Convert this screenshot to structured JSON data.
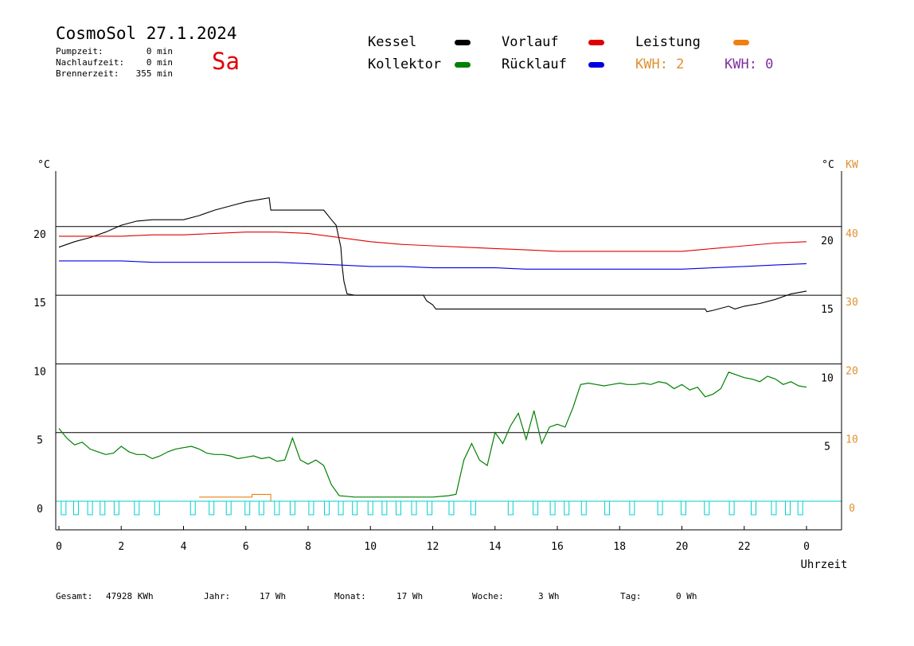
{
  "header": {
    "title": "CosmoSol 27.1.2024",
    "weekday": "Sa",
    "stats": [
      {
        "label": "Pumpzeit:",
        "value": "0 min"
      },
      {
        "label": "Nachlaufzeit:",
        "value": "0 min"
      },
      {
        "label": "Brennerzeit:",
        "value": "355 min"
      }
    ]
  },
  "legend": {
    "kessel": {
      "label": "Kessel",
      "color": "#000000"
    },
    "vorlauf": {
      "label": "Vorlauf",
      "color": "#e00000"
    },
    "leistung": {
      "label": "Leistung",
      "color": "#f08010"
    },
    "kollektor": {
      "label": "Kollektor",
      "color": "#008000"
    },
    "ruecklauf": {
      "label": "Rücklauf",
      "color": "#0000e0"
    },
    "kwh1": "KWH: 2",
    "kwh2": "KWH: 0",
    "kwh1_color": "#e09030",
    "kwh2_color": "#8030a0"
  },
  "footer": [
    {
      "label": "Gesamt:",
      "value": "47928 KWh"
    },
    {
      "label": "Jahr:",
      "value": "17 Wh"
    },
    {
      "label": "Monat:",
      "value": "17 Wh"
    },
    {
      "label": "Woche:",
      "value": "3 Wh"
    },
    {
      "label": "Tag:",
      "value": "0 Wh"
    }
  ],
  "chart_data": {
    "type": "line",
    "xlabel": "Uhrzeit",
    "y_unit_left": "°C",
    "y_unit_right": "°C",
    "y_unit_kw": "KW",
    "xlim": [
      0,
      24
    ],
    "ylim": [
      -2,
      24.5
    ],
    "x_ticks": [
      "0",
      "2",
      "4",
      "6",
      "8",
      "10",
      "12",
      "14",
      "16",
      "18",
      "20",
      "22",
      "0"
    ],
    "y_ticks_left": [
      "0",
      "5",
      "10",
      "15",
      "20"
    ],
    "y_ticks_right": [
      "5",
      "10",
      "15",
      "20"
    ],
    "kw_ticks": [
      "0",
      "10",
      "20",
      "30",
      "40"
    ],
    "series": [
      {
        "name": "Kessel",
        "color": "#000000",
        "x": [
          0,
          0.5,
          1,
          1.5,
          2,
          2.5,
          3,
          4,
          4.5,
          5,
          5.5,
          6,
          6.5,
          6.75,
          6.8,
          7,
          7.5,
          8,
          8.5,
          8.75,
          8.9,
          9.05,
          9.1,
          9.15,
          9.25,
          9.5,
          10,
          11,
          11.7,
          11.8,
          12,
          12.1,
          12.5,
          13,
          14,
          16,
          18,
          20,
          20.75,
          20.8,
          21,
          21.5,
          21.7,
          22,
          22.5,
          23,
          23.5,
          24
        ],
        "y": [
          18.5,
          18.9,
          19.2,
          19.6,
          20.1,
          20.4,
          20.5,
          20.5,
          20.8,
          21.2,
          21.5,
          21.8,
          22.0,
          22.1,
          21.2,
          21.2,
          21.2,
          21.2,
          21.2,
          20.5,
          20.1,
          18.5,
          17.0,
          16.0,
          15.1,
          15.0,
          15.0,
          15.0,
          15.0,
          14.6,
          14.3,
          14.0,
          14.0,
          14.0,
          14.0,
          14.0,
          14.0,
          14.0,
          14.0,
          13.8,
          13.9,
          14.2,
          14.0,
          14.2,
          14.4,
          14.7,
          15.1,
          15.3
        ]
      },
      {
        "name": "Vorlauf",
        "color": "#e00000",
        "x": [
          0,
          1,
          2,
          3,
          4,
          5,
          6,
          7,
          8,
          9,
          10,
          11,
          12,
          13,
          14,
          15,
          16,
          17,
          18,
          19,
          20,
          21,
          22,
          23,
          24
        ],
        "y": [
          19.3,
          19.3,
          19.3,
          19.4,
          19.4,
          19.5,
          19.6,
          19.6,
          19.5,
          19.2,
          18.9,
          18.7,
          18.6,
          18.5,
          18.4,
          18.3,
          18.2,
          18.2,
          18.2,
          18.2,
          18.2,
          18.4,
          18.6,
          18.8,
          18.9
        ]
      },
      {
        "name": "Rücklauf",
        "color": "#0000e0",
        "x": [
          0,
          1,
          2,
          3,
          4,
          5,
          6,
          7,
          8,
          9,
          10,
          11,
          12,
          13,
          14,
          15,
          16,
          17,
          18,
          19,
          20,
          21,
          22,
          23,
          24
        ],
        "y": [
          17.5,
          17.5,
          17.5,
          17.4,
          17.4,
          17.4,
          17.4,
          17.4,
          17.3,
          17.2,
          17.1,
          17.1,
          17.0,
          17.0,
          17.0,
          16.9,
          16.9,
          16.9,
          16.9,
          16.9,
          16.9,
          17.0,
          17.1,
          17.2,
          17.3
        ]
      },
      {
        "name": "Kollektor",
        "color": "#008000",
        "x": [
          0,
          0.25,
          0.5,
          0.75,
          1,
          1.25,
          1.5,
          1.75,
          2,
          2.25,
          2.5,
          2.75,
          3,
          3.25,
          3.5,
          3.75,
          4,
          4.25,
          4.5,
          4.75,
          5,
          5.25,
          5.5,
          5.75,
          6,
          6.25,
          6.5,
          6.75,
          7,
          7.25,
          7.5,
          7.75,
          8,
          8.25,
          8.5,
          8.75,
          9,
          9.5,
          10,
          10.5,
          11,
          11.5,
          12,
          12.5,
          12.75,
          13,
          13.25,
          13.5,
          13.75,
          14,
          14.25,
          14.5,
          14.75,
          15,
          15.25,
          15.5,
          15.75,
          16,
          16.25,
          16.5,
          16.75,
          17,
          17.25,
          17.5,
          17.75,
          18,
          18.25,
          18.5,
          18.75,
          19,
          19.25,
          19.5,
          19.75,
          20,
          20.25,
          20.5,
          20.75,
          21,
          21.25,
          21.5,
          21.75,
          22,
          22.25,
          22.5,
          22.75,
          23,
          23.25,
          23.5,
          23.75,
          24
        ],
        "y": [
          5.3,
          4.6,
          4.1,
          4.3,
          3.8,
          3.6,
          3.4,
          3.5,
          4.0,
          3.6,
          3.4,
          3.4,
          3.1,
          3.3,
          3.6,
          3.8,
          3.9,
          4.0,
          3.8,
          3.5,
          3.4,
          3.4,
          3.3,
          3.1,
          3.2,
          3.3,
          3.1,
          3.2,
          2.9,
          3.0,
          4.6,
          3.0,
          2.7,
          3.0,
          2.6,
          1.2,
          0.4,
          0.3,
          0.3,
          0.3,
          0.3,
          0.3,
          0.3,
          0.4,
          0.5,
          3.0,
          4.2,
          3.0,
          2.6,
          5.0,
          4.2,
          5.5,
          6.4,
          4.5,
          6.6,
          4.2,
          5.4,
          5.6,
          5.4,
          6.8,
          8.5,
          8.6,
          8.5,
          8.4,
          8.5,
          8.6,
          8.5,
          8.5,
          8.6,
          8.5,
          8.7,
          8.6,
          8.2,
          8.5,
          8.1,
          8.3,
          7.6,
          7.8,
          8.2,
          9.4,
          9.2,
          9.0,
          8.9,
          8.7,
          9.1,
          8.9,
          8.5,
          8.7,
          8.4,
          8.3
        ]
      },
      {
        "name": "Leistung",
        "color": "#f08010",
        "axis": "kw",
        "x": [
          4.5,
          4.8,
          4.8,
          5.1,
          5.1,
          5.5,
          5.5,
          5.9,
          5.9,
          6.2,
          6.2,
          6.5,
          6.5,
          6.8,
          6.8
        ],
        "y": [
          0.6,
          0.6,
          0.6,
          0.6,
          0.6,
          0.6,
          0.6,
          0.6,
          0.6,
          0.6,
          1.0,
          1.0,
          1.0,
          1.0,
          0.0
        ]
      },
      {
        "name": "Pumpe",
        "color": "#00d0d0",
        "type": "pulses",
        "x": [
          0.15,
          0.55,
          1.0,
          1.4,
          1.85,
          2.5,
          3.15,
          4.3,
          4.9,
          5.45,
          6.05,
          6.5,
          7.0,
          7.5,
          8.1,
          8.6,
          9.05,
          9.5,
          10.0,
          10.45,
          10.9,
          11.4,
          11.9,
          12.6,
          13.3,
          14.5,
          15.3,
          15.85,
          16.3,
          16.85,
          17.6,
          18.4,
          19.3,
          20.05,
          20.8,
          21.6,
          22.3,
          22.95,
          23.4,
          23.8
        ]
      }
    ]
  }
}
